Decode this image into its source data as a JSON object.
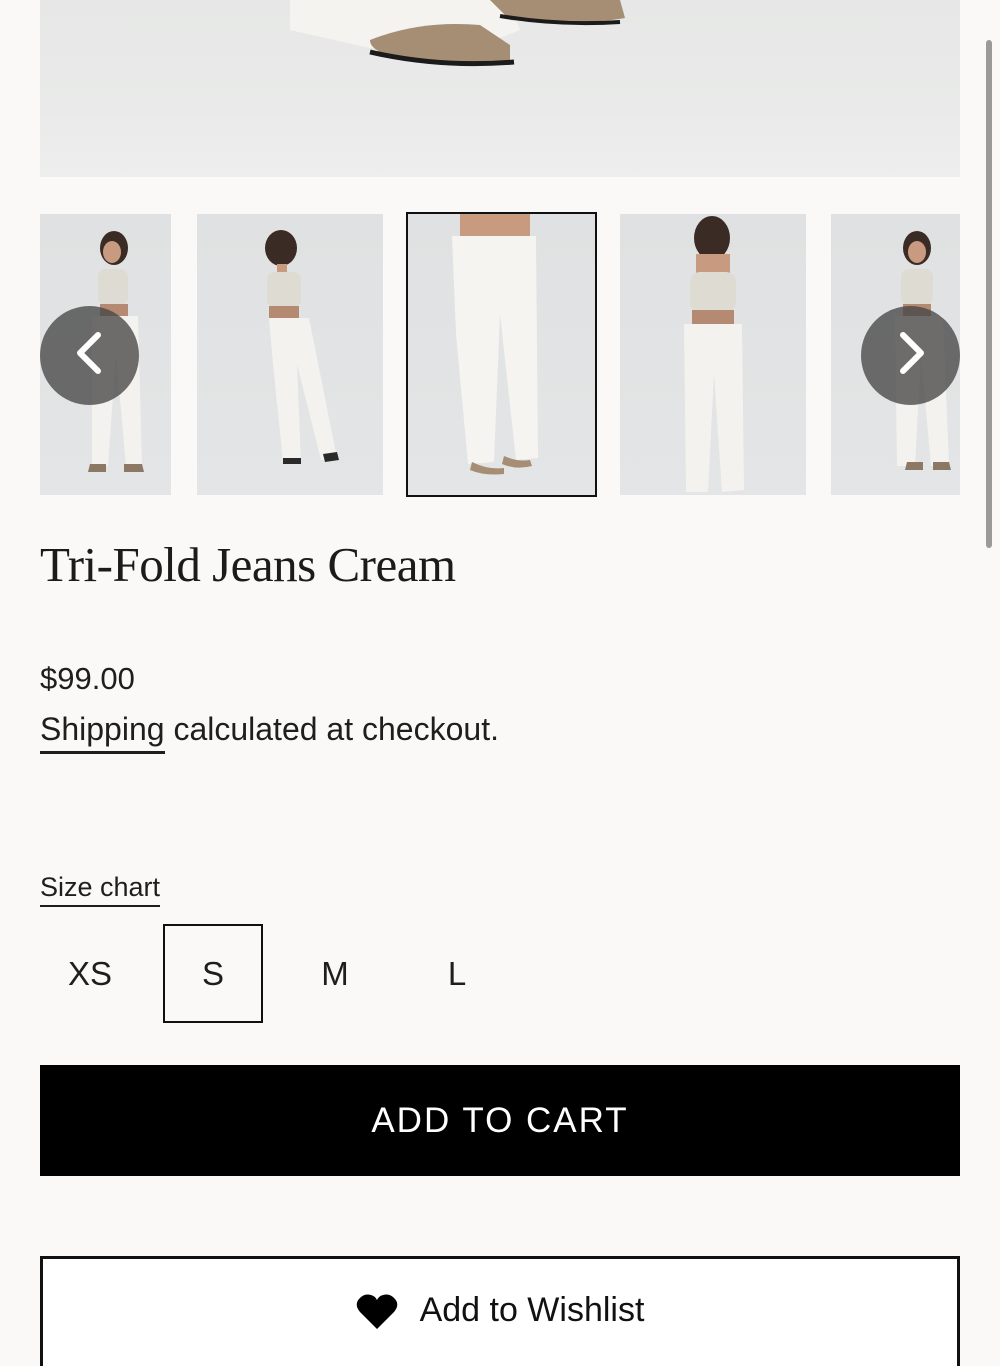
{
  "product": {
    "title": "Tri-Fold Jeans Cream",
    "price": "$99.00",
    "shipping_link": "Shipping",
    "shipping_text": " calculated at checkout."
  },
  "gallery": {
    "thumbnail_count": 5,
    "selected_index": 2
  },
  "sizes": {
    "chart_link": "Size chart",
    "options": [
      "XS",
      "S",
      "M",
      "L"
    ],
    "selected": "S"
  },
  "actions": {
    "add_to_cart": "ADD TO CART",
    "wishlist": "Add to Wishlist"
  },
  "icons": {
    "prev": "chevron-left-icon",
    "next": "chevron-right-icon",
    "wishlist": "heart-icon"
  },
  "colors": {
    "background": "#faf9f7",
    "button": "#000000",
    "button_text": "#ffffff",
    "carousel_button": "#464646"
  }
}
